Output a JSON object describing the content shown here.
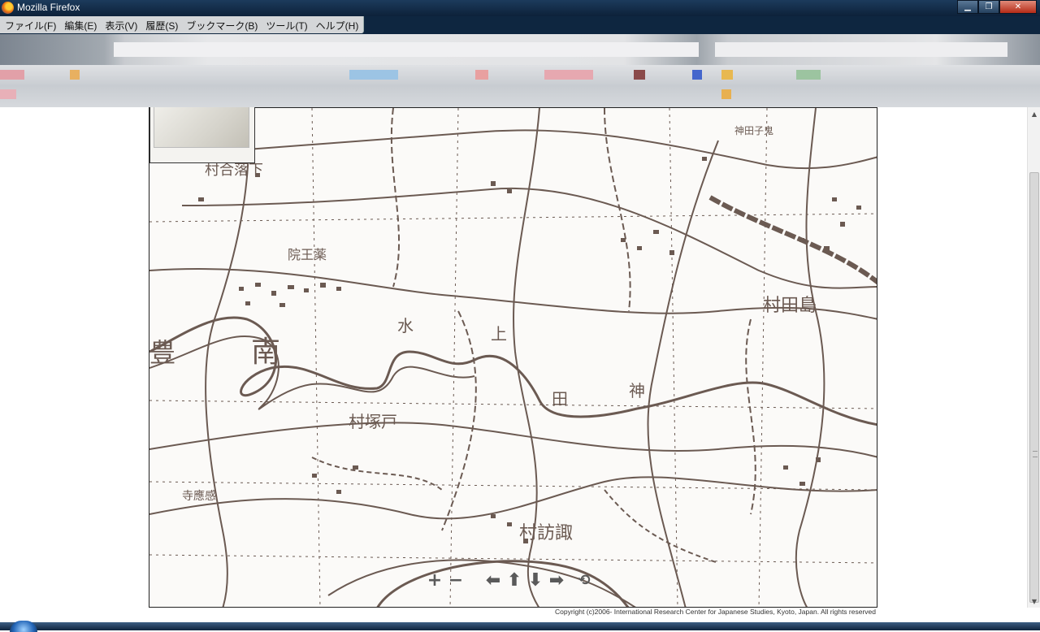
{
  "window": {
    "title": "Mozilla Firefox",
    "minimize": "▁",
    "restore": "❐",
    "close": "✕"
  },
  "menu": {
    "items": [
      "ファイル(F)",
      "編集(E)",
      "表示(V)",
      "履歴(S)",
      "ブックマーク(B)",
      "ツール(T)",
      "ヘルプ(H)"
    ]
  },
  "map": {
    "labels": [
      "村合落下",
      "院王薬",
      "村田島",
      "南",
      "豊",
      "水",
      "上",
      "田",
      "神",
      "村塚戸",
      "寺應感",
      "村訪諏",
      "神田子鬼"
    ],
    "copyright": "Copyright (c)2006- International Research Center for Japanese Studies, Kyoto, Japan. All rights reserved"
  },
  "controls": {
    "zoom_in": "+",
    "zoom_out": "−",
    "pan_left": "⬅",
    "pan_up": "⬆",
    "pan_down": "⬇",
    "pan_right": "➡",
    "reset": "⟲"
  },
  "colors": {
    "map_ink": "#6b5a52",
    "map_paper": "#fbfaf8",
    "titlebar": "#0d2139"
  }
}
